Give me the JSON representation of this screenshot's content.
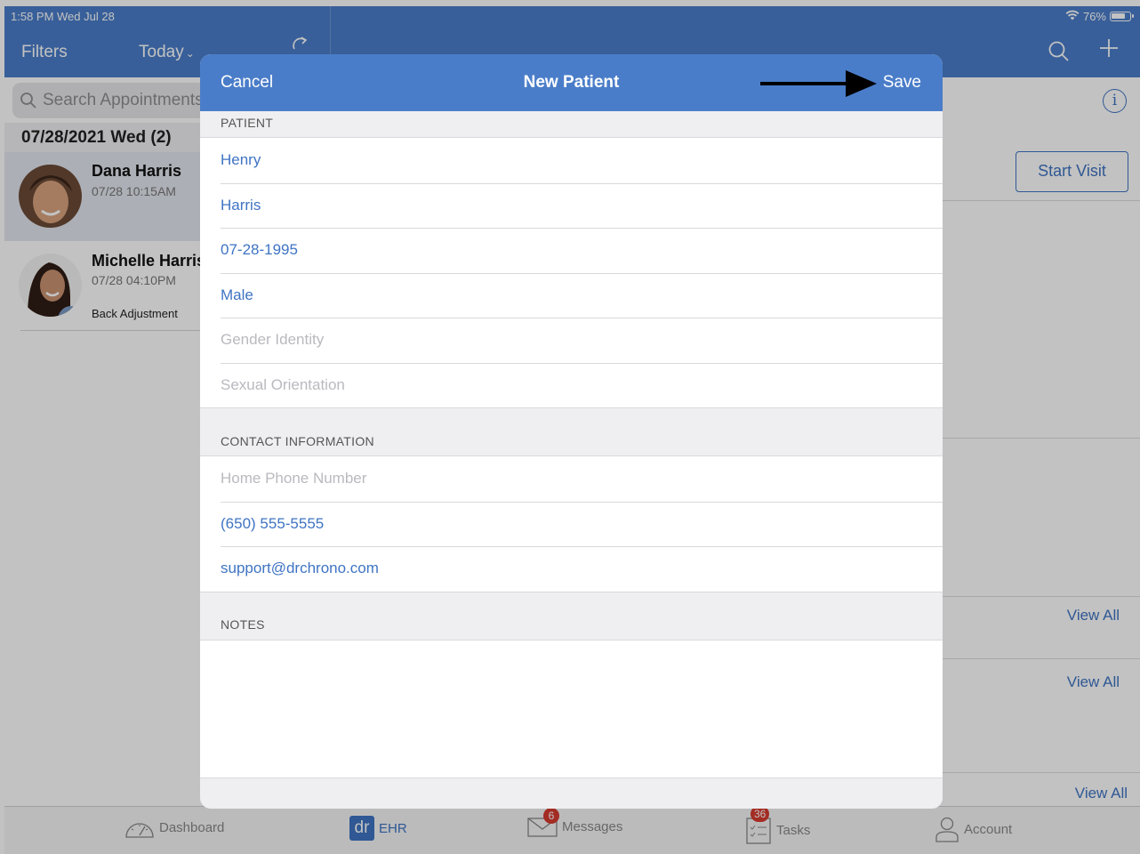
{
  "status_bar": {
    "time": "1:58 PM  Wed Jul 28",
    "battery": "76%"
  },
  "header": {
    "filters_label": "Filters",
    "today_label": "Today"
  },
  "appointments": {
    "search_placeholder": "Search Appointments",
    "date_header": "07/28/2021 Wed (2)",
    "items": [
      {
        "name": "Dana Harris",
        "time": "07/28 10:15AM",
        "reason": ""
      },
      {
        "name": "Michelle Harris",
        "time": "07/28 04:10PM",
        "reason": "Back Adjustment"
      }
    ]
  },
  "detail": {
    "start_visit_label": "Start Visit",
    "view_all_labels": [
      "View All",
      "View All",
      "View All"
    ]
  },
  "modal": {
    "title": "New Patient",
    "cancel_label": "Cancel",
    "save_label": "Save",
    "patient_section": "PATIENT",
    "patient_fields": {
      "first_name": "Henry",
      "last_name": "Harris",
      "dob": "07-28-1995",
      "gender": "Male",
      "gender_identity_placeholder": "Gender Identity",
      "sexual_orientation_placeholder": "Sexual Orientation"
    },
    "contact_section": "CONTACT INFORMATION",
    "contact_fields": {
      "home_phone_placeholder": "Home Phone Number",
      "cell_phone": "(650) 555-5555",
      "email": "support@drchrono.com"
    },
    "notes_section": "NOTES",
    "notes_value": ""
  },
  "tabbar": {
    "dashboard": "Dashboard",
    "ehr_logo": "dr",
    "ehr": "EHR",
    "messages": "Messages",
    "messages_badge": "6",
    "tasks": "Tasks",
    "tasks_badge": "36",
    "account": "Account"
  },
  "colors": {
    "brand": "#4a7dc9",
    "link": "#3f74c3",
    "badge": "#d63a2f"
  }
}
